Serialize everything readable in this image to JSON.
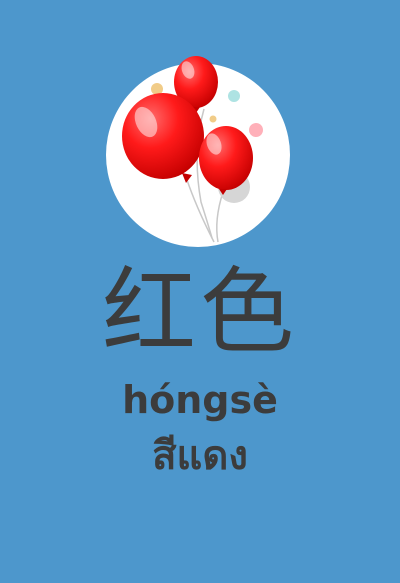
{
  "card": {
    "background_color": "#4d97cc",
    "text_color": "#3c3c3c",
    "illustration_icon": "red-balloons-icon",
    "balloon_color": "#e50f14",
    "hanzi": "红色",
    "pinyin": "hóngsè",
    "thai": "สีแดง"
  }
}
